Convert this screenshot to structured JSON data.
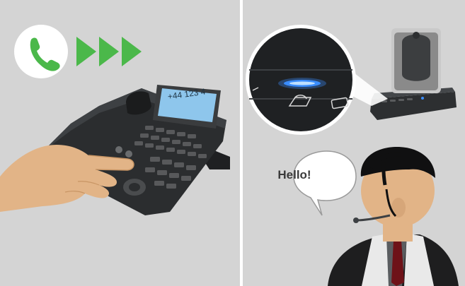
{
  "phone_display": {
    "number": "+44 123 4"
  },
  "speech_bubble": {
    "text": "Hello!"
  },
  "icons": {
    "call": "phone-handset-icon",
    "arrows": "play-arrows-icon",
    "base_button": "headset-button-icon",
    "mobile_button": "mobile-phone-icon"
  },
  "colors": {
    "panel_bg": "#d4d4d4",
    "call_green": "#4bb84a",
    "led_blue": "#3a8dff",
    "phone_body": "#2f3133",
    "display_blue": "#8ec6ec"
  }
}
